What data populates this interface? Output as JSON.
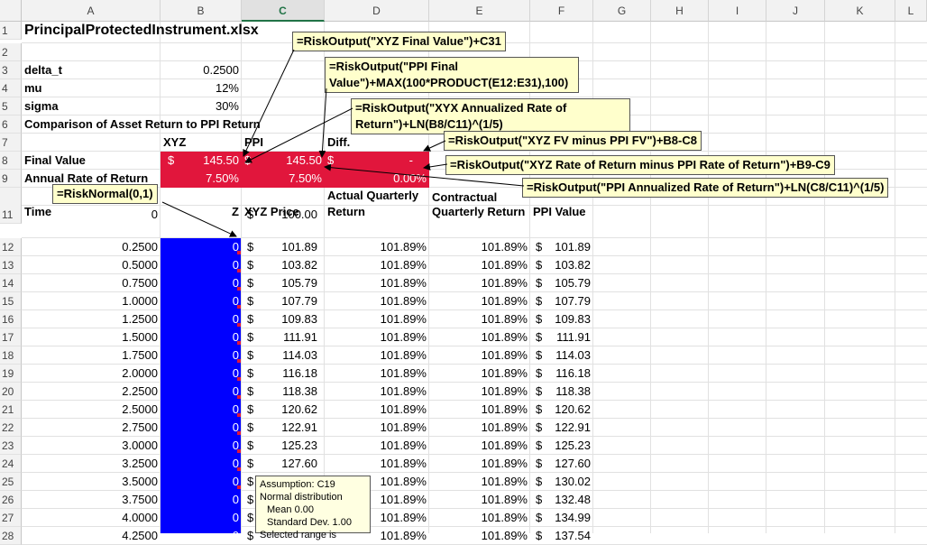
{
  "columns": [
    "A",
    "B",
    "C",
    "D",
    "E",
    "F",
    "G",
    "H",
    "I",
    "J",
    "K",
    "L"
  ],
  "selected_column": "C",
  "rows": [
    "1",
    "2",
    "3",
    "4",
    "5",
    "6",
    "7",
    "8",
    "9",
    "10",
    "11",
    "12",
    "13",
    "14",
    "15",
    "16",
    "17",
    "18",
    "19",
    "20",
    "21",
    "22",
    "23",
    "24",
    "25",
    "26",
    "27",
    "28"
  ],
  "title": "PrincipalProtectedInstrument.xlsx",
  "params": [
    {
      "label": "delta_t",
      "value": "0.2500"
    },
    {
      "label": "mu",
      "value": "12%"
    },
    {
      "label": "sigma",
      "value": "30%"
    }
  ],
  "comparison_heading": "Comparison of Asset Return to PPI Return",
  "summary_headers": {
    "xyz": "XYZ",
    "ppi": "PPI",
    "diff": "Diff."
  },
  "final_value": {
    "label": "Final Value",
    "xyz_cur": "$",
    "xyz": "145.50",
    "ppi_cur": "$",
    "ppi": "145.50",
    "diff_cur": "$",
    "diff": "-"
  },
  "annual_rate": {
    "label": "Annual Rate of Return",
    "xyz": "7.50%",
    "ppi": "7.50%",
    "diff": "0.00%"
  },
  "table_headers": {
    "time": "Time",
    "z": "Z",
    "xyz_price": "XYZ Price",
    "actual_q_1": "Actual Quarterly",
    "actual_q_2": "Return",
    "contract_q_1": "Contractual",
    "contract_q_2": "Quarterly Return",
    "ppi_value": "PPI Value"
  },
  "table_rows": [
    {
      "time": "0",
      "z": "",
      "price": "100.00",
      "actual": "",
      "contract": "",
      "ppi": ""
    },
    {
      "time": "0.2500",
      "z": "0",
      "price": "101.89",
      "actual": "101.89%",
      "contract": "101.89%",
      "ppi": "101.89"
    },
    {
      "time": "0.5000",
      "z": "0",
      "price": "103.82",
      "actual": "101.89%",
      "contract": "101.89%",
      "ppi": "103.82"
    },
    {
      "time": "0.7500",
      "z": "0",
      "price": "105.79",
      "actual": "101.89%",
      "contract": "101.89%",
      "ppi": "105.79"
    },
    {
      "time": "1.0000",
      "z": "0",
      "price": "107.79",
      "actual": "101.89%",
      "contract": "101.89%",
      "ppi": "107.79"
    },
    {
      "time": "1.2500",
      "z": "0",
      "price": "109.83",
      "actual": "101.89%",
      "contract": "101.89%",
      "ppi": "109.83"
    },
    {
      "time": "1.5000",
      "z": "0",
      "price": "111.91",
      "actual": "101.89%",
      "contract": "101.89%",
      "ppi": "111.91"
    },
    {
      "time": "1.7500",
      "z": "0",
      "price": "114.03",
      "actual": "101.89%",
      "contract": "101.89%",
      "ppi": "114.03"
    },
    {
      "time": "2.0000",
      "z": "0",
      "price": "116.18",
      "actual": "101.89%",
      "contract": "101.89%",
      "ppi": "116.18"
    },
    {
      "time": "2.2500",
      "z": "0",
      "price": "118.38",
      "actual": "101.89%",
      "contract": "101.89%",
      "ppi": "118.38"
    },
    {
      "time": "2.5000",
      "z": "0",
      "price": "120.62",
      "actual": "101.89%",
      "contract": "101.89%",
      "ppi": "120.62"
    },
    {
      "time": "2.7500",
      "z": "0",
      "price": "122.91",
      "actual": "101.89%",
      "contract": "101.89%",
      "ppi": "122.91"
    },
    {
      "time": "3.0000",
      "z": "0",
      "price": "125.23",
      "actual": "101.89%",
      "contract": "101.89%",
      "ppi": "125.23"
    },
    {
      "time": "3.2500",
      "z": "0",
      "price": "127.60",
      "actual": "101.89%",
      "contract": "101.89%",
      "ppi": "127.60"
    },
    {
      "time": "3.5000",
      "z": "0",
      "price": "130.02",
      "actual": "101.89%",
      "contract": "101.89%",
      "ppi": "130.02"
    },
    {
      "time": "3.7500",
      "z": "0",
      "price": "",
      "actual": "101.89%",
      "contract": "101.89%",
      "ppi": "132.48"
    },
    {
      "time": "4.0000",
      "z": "0",
      "price": "",
      "actual": "101.89%",
      "contract": "101.89%",
      "ppi": "134.99"
    },
    {
      "time": "4.2500",
      "z": "0",
      "price": "",
      "actual": "101.89%",
      "contract": "101.89%",
      "ppi": "137.54"
    }
  ],
  "currency": "$",
  "notes": {
    "c31": "=RiskOutput(\"XYZ Final Value\")+C31",
    "ppi_final_1": "=RiskOutput(\"PPI Final",
    "ppi_final_2": "Value\")+MAX(100*PRODUCT(E12:E31),100)",
    "xyx_rate_1": "=RiskOutput(\"XYX Annualized Rate of",
    "xyx_rate_2": "Return\")+LN(B8/C11)^(1/5)",
    "fv_minus": "=RiskOutput(\"XYZ FV minus PPI FV\")+B8-C8",
    "rate_minus": "=RiskOutput(\"XYZ Rate of Return minus PPI Rate of Return\")+B9-C9",
    "ppi_rate": "=RiskOutput(\"PPI Annualized Rate of Return\")+LN(C8/C11)^(1/5)",
    "risk_normal": "=RiskNormal(0,1)"
  },
  "tooltip": {
    "line1": "Assumption: C19",
    "line2": "Normal distribution",
    "line3": "Mean 0.00",
    "line4": "Standard Dev. 1.00",
    "line5": "Selected range is"
  },
  "colors": {
    "red_fill": "#e1163c",
    "blue_fill": "#0000ff",
    "note_bg": "#ffffcc",
    "arrow": "#000000"
  }
}
